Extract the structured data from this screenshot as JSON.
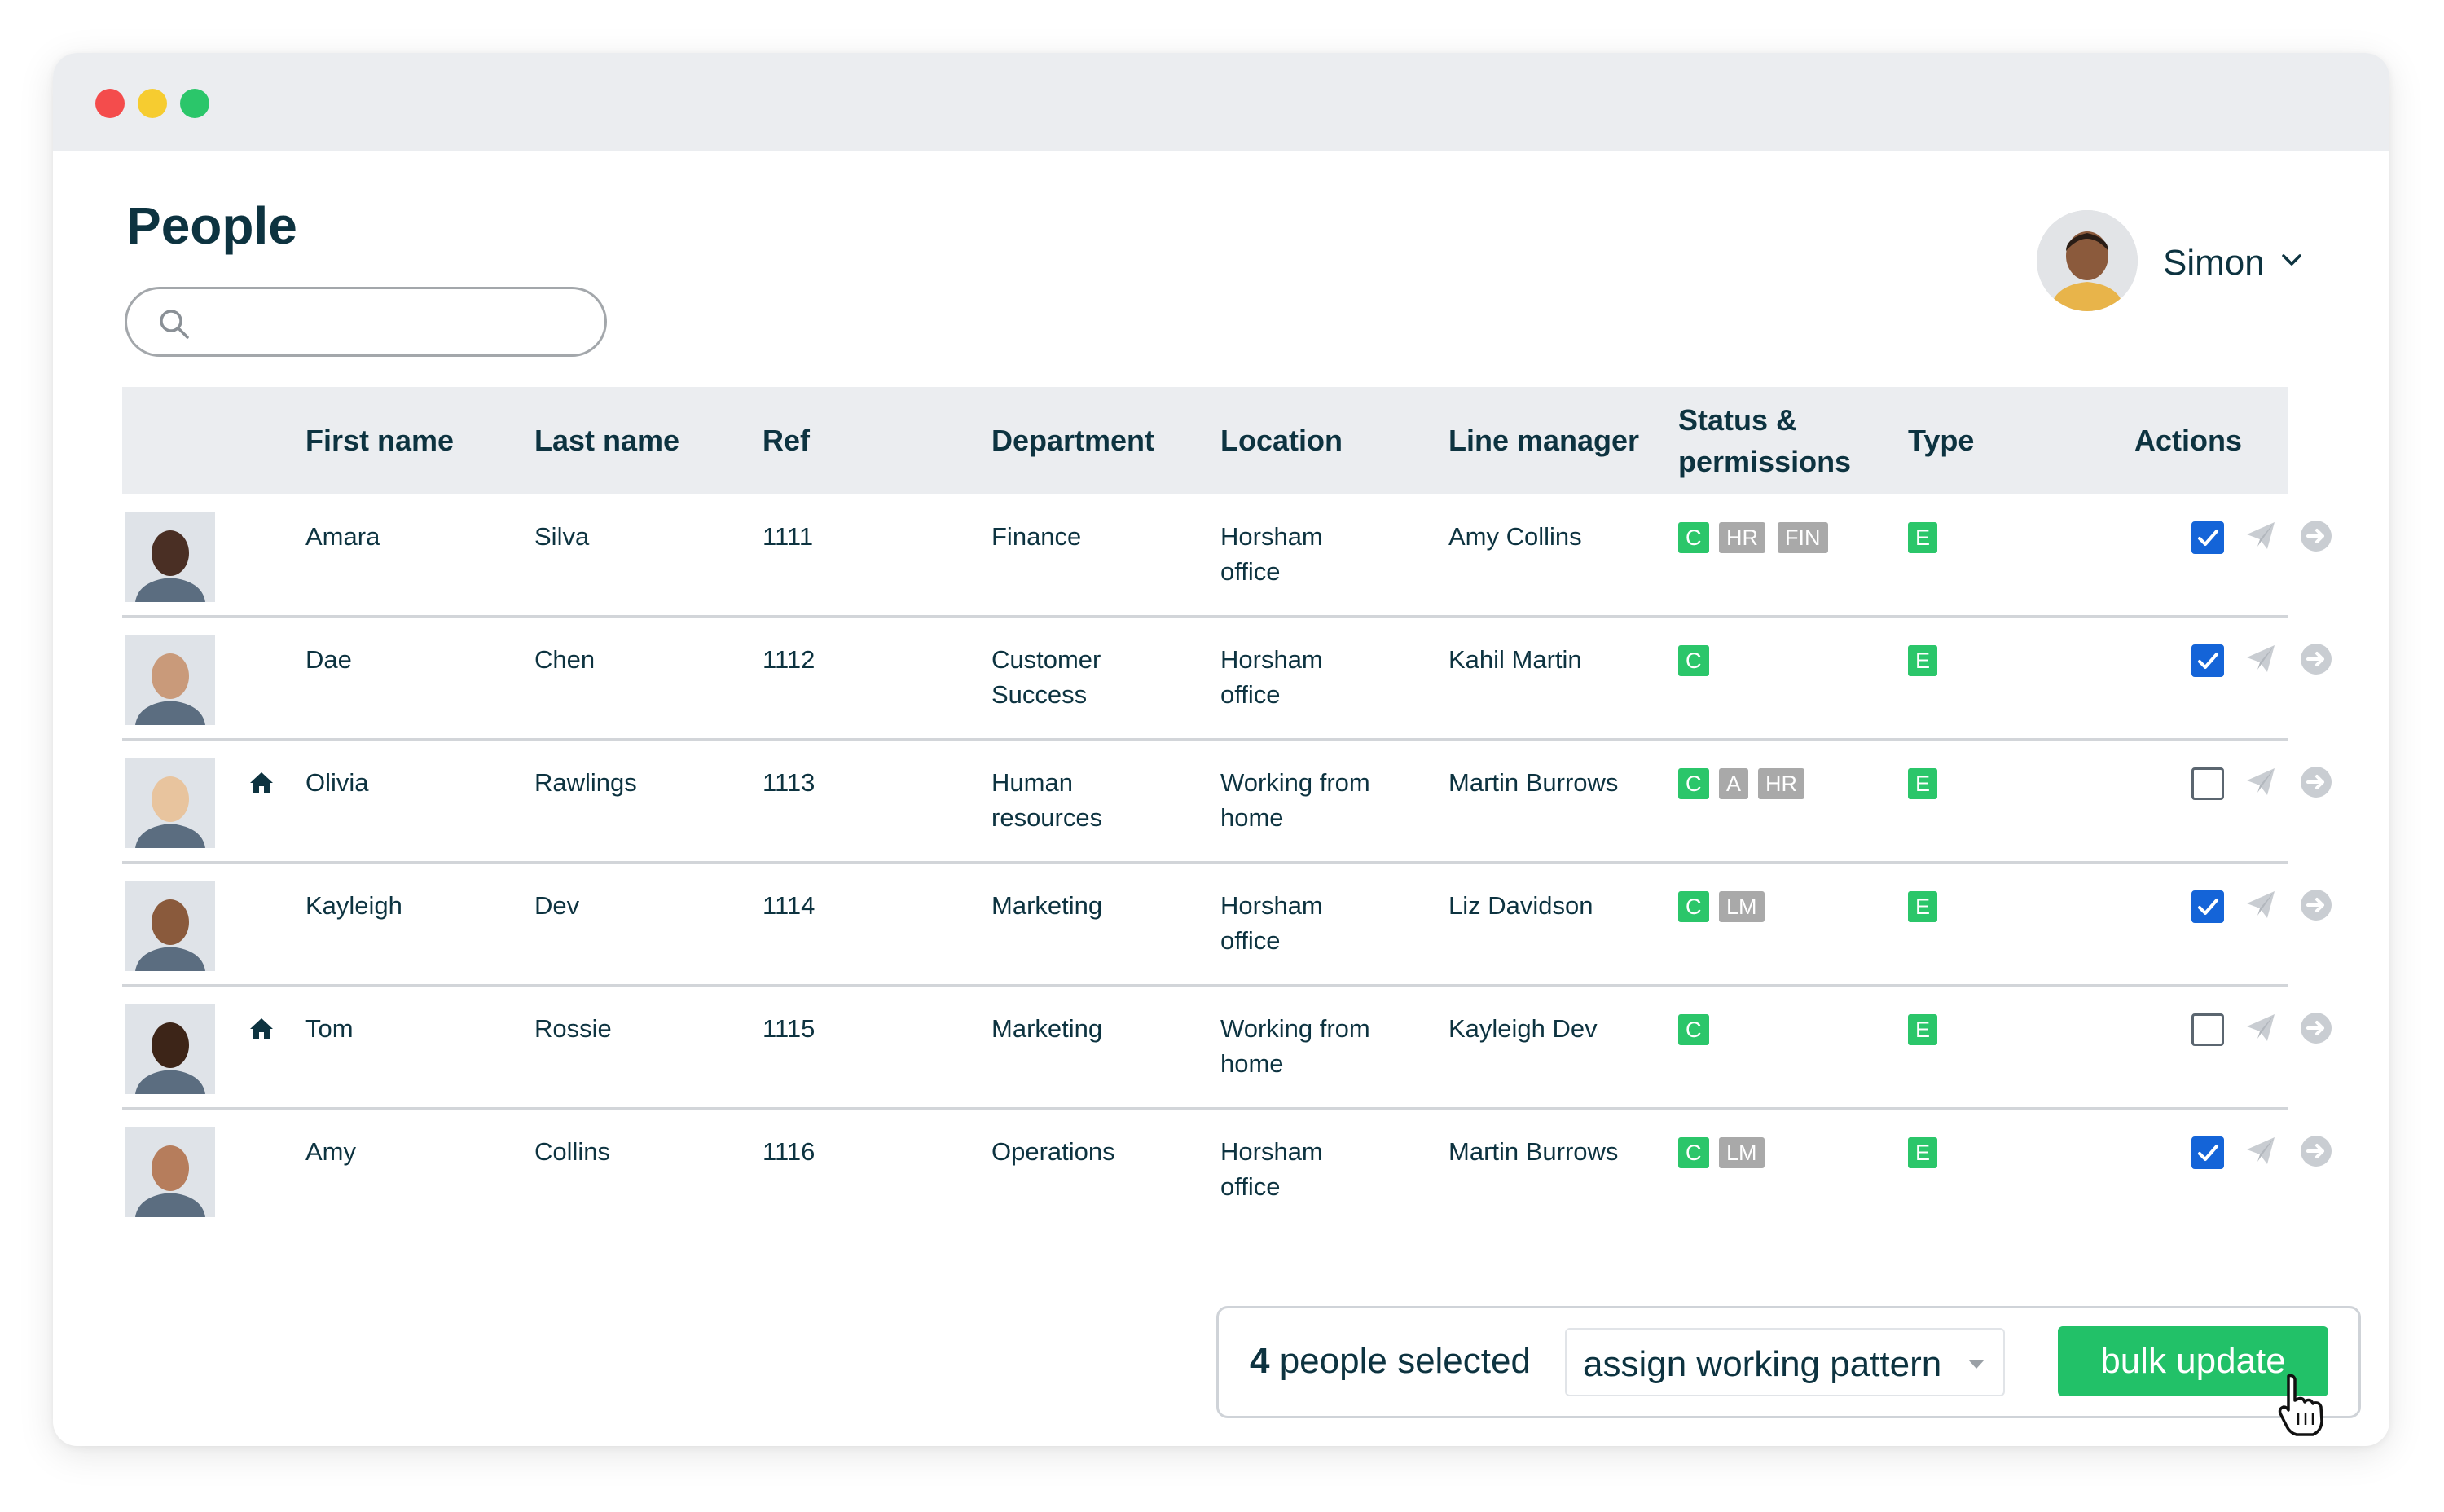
{
  "window": {
    "buttons": [
      "close",
      "minimize",
      "maximize"
    ]
  },
  "page": {
    "title": "People"
  },
  "search": {
    "placeholder": "",
    "value": ""
  },
  "user": {
    "name": "Simon"
  },
  "table": {
    "headers": {
      "first_name": "First name",
      "last_name": "Last name",
      "ref": "Ref",
      "department": "Department",
      "location": "Location",
      "line_manager": "Line manager",
      "status_line1": "Status &",
      "status_line2": "permissions",
      "type": "Type",
      "actions": "Actions"
    },
    "rows": [
      {
        "first": "Amara",
        "last": "Silva",
        "ref": "1111",
        "dept": [
          "Finance",
          ""
        ],
        "loc": [
          "Horsham",
          "office"
        ],
        "manager": "Amy Collins",
        "home": false,
        "badges": [
          "C",
          "HR",
          "FIN"
        ],
        "type": "E",
        "selected": true
      },
      {
        "first": "Dae",
        "last": "Chen",
        "ref": "1112",
        "dept": [
          "Customer",
          "Success"
        ],
        "loc": [
          "Horsham",
          "office"
        ],
        "manager": "Kahil Martin",
        "home": false,
        "badges": [
          "C"
        ],
        "type": "E",
        "selected": true
      },
      {
        "first": "Olivia",
        "last": "Rawlings",
        "ref": "1113",
        "dept": [
          "Human",
          "resources"
        ],
        "loc": [
          "Working from",
          "home"
        ],
        "manager": "Martin Burrows",
        "home": true,
        "badges": [
          "C",
          "A",
          "HR"
        ],
        "type": "E",
        "selected": false
      },
      {
        "first": "Kayleigh",
        "last": "Dev",
        "ref": "1114",
        "dept": [
          "Marketing",
          ""
        ],
        "loc": [
          "Horsham",
          "office"
        ],
        "manager": "Liz Davidson",
        "home": false,
        "badges": [
          "C",
          "LM"
        ],
        "type": "E",
        "selected": true
      },
      {
        "first": "Tom",
        "last": "Rossie",
        "ref": "1115",
        "dept": [
          "Marketing",
          ""
        ],
        "loc": [
          "Working from",
          "home"
        ],
        "manager": "Kayleigh Dev",
        "home": true,
        "badges": [
          "C"
        ],
        "type": "E",
        "selected": false
      },
      {
        "first": "Amy",
        "last": "Collins",
        "ref": "1116",
        "dept": [
          "Operations",
          ""
        ],
        "loc": [
          "Horsham",
          "office"
        ],
        "manager": "Martin Burrows",
        "home": false,
        "badges": [
          "C",
          "LM"
        ],
        "type": "E",
        "selected": true
      }
    ]
  },
  "bulk": {
    "count": "4",
    "count_suffix": " people selected",
    "action": "assign working pattern",
    "button": "bulk update"
  },
  "colors": {
    "accent_green": "#22c168",
    "badge_grey": "#a9a9a9",
    "checkbox_blue": "#1464d8",
    "heading_navy": "#0d3340"
  },
  "icons": [
    "search-icon",
    "chevron-down-icon",
    "home-icon",
    "send-icon",
    "arrow-right-circle-icon",
    "caret-down-icon",
    "hand-cursor-icon"
  ]
}
